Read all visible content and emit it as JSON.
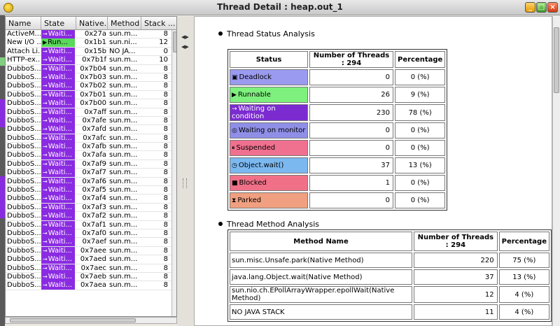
{
  "window": {
    "title": "Thread Detail : heap.out_1"
  },
  "colors": {
    "waiting": "#8a2be2",
    "runnable": "#5ad85a",
    "deadlock": "#9a9af0",
    "waiting_on_condition": "#7b2bd0",
    "waiting_on_monitor": "#8f8fe8",
    "suspended": "#f07090",
    "object_wait": "#7cb8f0",
    "blocked": "#f07088",
    "parked": "#f0a080"
  },
  "thread_table": {
    "columns": [
      "Name",
      "State",
      "Native...",
      "Method",
      "Stack ..."
    ],
    "rows": [
      {
        "name": "ActiveM...",
        "state": "Waiti...",
        "state_type": "waiting",
        "native": "0x27a",
        "method": "sun.m...",
        "stack": "8"
      },
      {
        "name": "New I/O ...",
        "state": "Run...",
        "state_type": "runnable",
        "native": "0x1b1",
        "method": "sun.ni...",
        "stack": "12"
      },
      {
        "name": "Attach Li...",
        "state": "Waiti...",
        "state_type": "waiting",
        "native": "0x15b",
        "method": "NO JA...",
        "stack": "0"
      },
      {
        "name": "HTTP-ex...",
        "state": "Waiti...",
        "state_type": "waiting",
        "native": "0x7b1f",
        "method": "sun.m...",
        "stack": "10"
      },
      {
        "name": "DubboS...",
        "state": "Waiti...",
        "state_type": "waiting",
        "native": "0x7b04",
        "method": "sun.m...",
        "stack": "8"
      },
      {
        "name": "DubboS...",
        "state": "Waiti...",
        "state_type": "waiting",
        "native": "0x7b03",
        "method": "sun.m...",
        "stack": "8"
      },
      {
        "name": "DubboS...",
        "state": "Waiti...",
        "state_type": "waiting",
        "native": "0x7b02",
        "method": "sun.m...",
        "stack": "8"
      },
      {
        "name": "DubboS...",
        "state": "Waiti...",
        "state_type": "waiting",
        "native": "0x7b01",
        "method": "sun.m...",
        "stack": "8"
      },
      {
        "name": "DubboS...",
        "state": "Waiti...",
        "state_type": "waiting",
        "native": "0x7b00",
        "method": "sun.m...",
        "stack": "8"
      },
      {
        "name": "DubboS...",
        "state": "Waiti...",
        "state_type": "waiting",
        "native": "0x7aff",
        "method": "sun.m...",
        "stack": "8"
      },
      {
        "name": "DubboS...",
        "state": "Waiti...",
        "state_type": "waiting",
        "native": "0x7afe",
        "method": "sun.m...",
        "stack": "8"
      },
      {
        "name": "DubboS...",
        "state": "Waiti...",
        "state_type": "waiting",
        "native": "0x7afd",
        "method": "sun.m...",
        "stack": "8"
      },
      {
        "name": "DubboS...",
        "state": "Waiti...",
        "state_type": "waiting",
        "native": "0x7afc",
        "method": "sun.m...",
        "stack": "8"
      },
      {
        "name": "DubboS...",
        "state": "Waiti...",
        "state_type": "waiting",
        "native": "0x7afb",
        "method": "sun.m...",
        "stack": "8"
      },
      {
        "name": "DubboS...",
        "state": "Waiti...",
        "state_type": "waiting",
        "native": "0x7afa",
        "method": "sun.m...",
        "stack": "8"
      },
      {
        "name": "DubboS...",
        "state": "Waiti...",
        "state_type": "waiting",
        "native": "0x7af9",
        "method": "sun.m...",
        "stack": "8"
      },
      {
        "name": "DubboS...",
        "state": "Waiti...",
        "state_type": "waiting",
        "native": "0x7af7",
        "method": "sun.m...",
        "stack": "8"
      },
      {
        "name": "DubboS...",
        "state": "Waiti...",
        "state_type": "waiting",
        "native": "0x7af6",
        "method": "sun.m...",
        "stack": "8"
      },
      {
        "name": "DubboS...",
        "state": "Waiti...",
        "state_type": "waiting",
        "native": "0x7af5",
        "method": "sun.m...",
        "stack": "8"
      },
      {
        "name": "DubboS...",
        "state": "Waiti...",
        "state_type": "waiting",
        "native": "0x7af4",
        "method": "sun.m...",
        "stack": "8"
      },
      {
        "name": "DubboS...",
        "state": "Waiti...",
        "state_type": "waiting",
        "native": "0x7af3",
        "method": "sun.m...",
        "stack": "8"
      },
      {
        "name": "DubboS...",
        "state": "Waiti...",
        "state_type": "waiting",
        "native": "0x7af2",
        "method": "sun.m...",
        "stack": "8"
      },
      {
        "name": "DubboS...",
        "state": "Waiti...",
        "state_type": "waiting",
        "native": "0x7af1",
        "method": "sun.m...",
        "stack": "8"
      },
      {
        "name": "DubboS...",
        "state": "Waiti...",
        "state_type": "waiting",
        "native": "0x7af0",
        "method": "sun.m...",
        "stack": "8"
      },
      {
        "name": "DubboS...",
        "state": "Waiti...",
        "state_type": "waiting",
        "native": "0x7aef",
        "method": "sun.m...",
        "stack": "8"
      },
      {
        "name": "DubboS...",
        "state": "Waiti...",
        "state_type": "waiting",
        "native": "0x7aee",
        "method": "sun.m...",
        "stack": "8"
      },
      {
        "name": "DubboS...",
        "state": "Waiti...",
        "state_type": "waiting",
        "native": "0x7aed",
        "method": "sun.m...",
        "stack": "8"
      },
      {
        "name": "DubboS...",
        "state": "Waiti...",
        "state_type": "waiting",
        "native": "0x7aec",
        "method": "sun.m...",
        "stack": "8"
      },
      {
        "name": "DubboS...",
        "state": "Waiti...",
        "state_type": "waiting",
        "native": "0x7aeb",
        "method": "sun.m...",
        "stack": "8"
      },
      {
        "name": "DubboS...",
        "state": "Waiti...",
        "state_type": "waiting",
        "native": "0x7aea",
        "method": "sun.m...",
        "stack": "8"
      }
    ]
  },
  "status_analysis": {
    "title": "Thread Status Analysis",
    "headers": [
      "Status",
      "Number of Threads : 294",
      "Percentage"
    ],
    "rows": [
      {
        "status": "Deadlock",
        "icon": "lock-icon",
        "color": "#9a9af0",
        "count": "0",
        "pct": "0 (%)"
      },
      {
        "status": "Runnable",
        "icon": "play-icon",
        "color": "#7ef07e",
        "count": "26",
        "pct": "9 (%)"
      },
      {
        "status": "Waiting on condition",
        "icon": "arrow-icon",
        "color": "#7b2bd0",
        "count": "230",
        "pct": "78 (%)"
      },
      {
        "status": "Waiting on monitor",
        "icon": "monitor-icon",
        "color": "#8f8fe8",
        "count": "0",
        "pct": "0 (%)"
      },
      {
        "status": "Suspended",
        "icon": "pause-icon",
        "color": "#f07090",
        "count": "0",
        "pct": "0 (%)"
      },
      {
        "status": "Object.wait()",
        "icon": "clock-icon",
        "color": "#7cb8f0",
        "count": "37",
        "pct": "13 (%)"
      },
      {
        "status": "Blocked",
        "icon": "block-icon",
        "color": "#f07088",
        "count": "1",
        "pct": "0 (%)"
      },
      {
        "status": "Parked",
        "icon": "hourglass-icon",
        "color": "#f0a080",
        "count": "0",
        "pct": "0 (%)"
      }
    ]
  },
  "method_analysis": {
    "title": "Thread Method Analysis",
    "headers": [
      "Method Name",
      "Number of Threads : 294",
      "Percentage"
    ],
    "rows": [
      {
        "method": "sun.misc.Unsafe.park(Native Method)",
        "count": "220",
        "pct": "75 (%)"
      },
      {
        "method": "java.lang.Object.wait(Native Method)",
        "count": "37",
        "pct": "13 (%)"
      },
      {
        "method": "sun.nio.ch.EPollArrayWrapper.epollWait(Native Method)",
        "count": "12",
        "pct": "4 (%)"
      },
      {
        "method": "NO JAVA STACK",
        "count": "11",
        "pct": "4 (%)"
      }
    ]
  }
}
